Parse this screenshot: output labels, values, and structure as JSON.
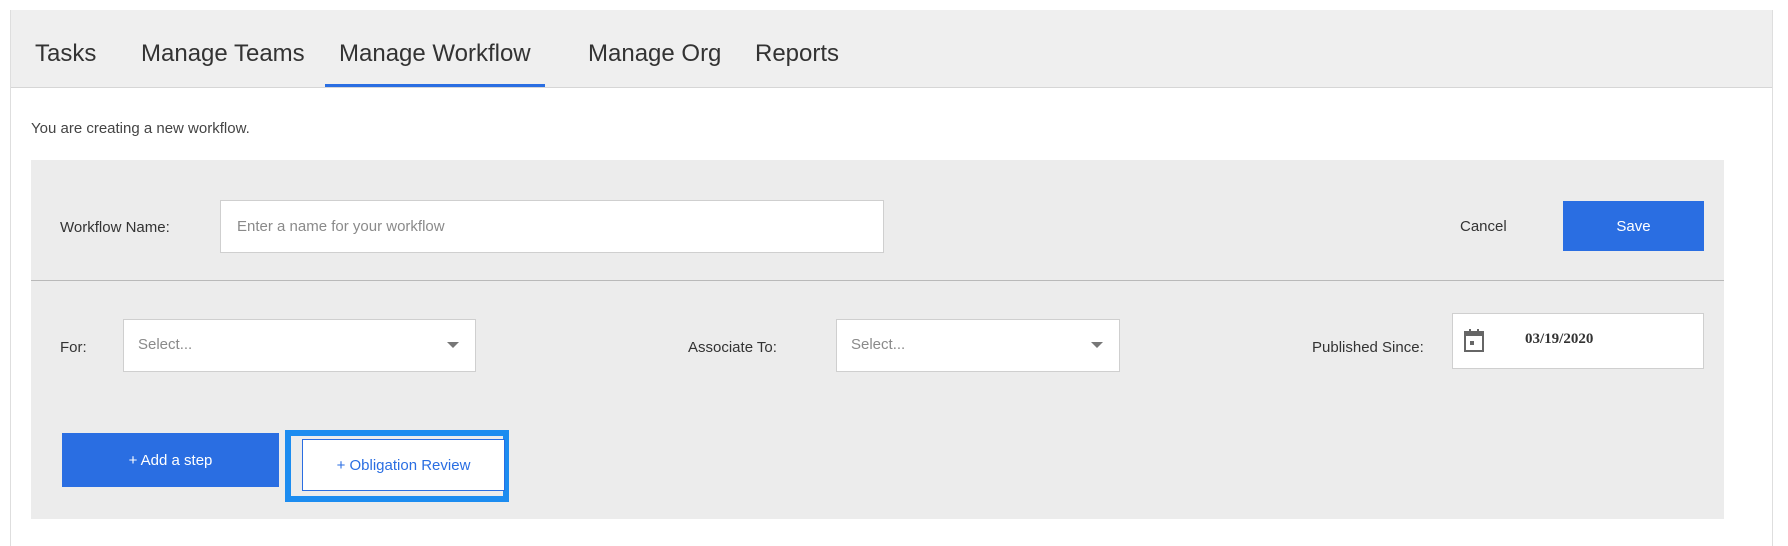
{
  "tabs": [
    {
      "label": "Tasks"
    },
    {
      "label": "Manage Teams"
    },
    {
      "label": "Manage Workflow",
      "active": true
    },
    {
      "label": "Manage Org"
    },
    {
      "label": "Reports"
    }
  ],
  "intro_text": "You are creating a new workflow.",
  "form": {
    "workflow_name_label": "Workflow Name:",
    "workflow_name_placeholder": "Enter a name for your workflow",
    "workflow_name_value": "",
    "cancel_label": "Cancel",
    "save_label": "Save",
    "for_label": "For:",
    "for_select_value": "Select...",
    "associate_label": "Associate To:",
    "associate_select_value": "Select...",
    "published_since_label": "Published Since:",
    "published_since_value": "03/19/2020",
    "calendar_icon": "calendar-icon",
    "add_step_label": "+ Add a step",
    "obligation_review_label": "+ Obligation Review"
  },
  "colors": {
    "accent": "#2a6ee2",
    "highlight": "#1c8cf0",
    "panel_bg": "#ececec",
    "tabbar_bg": "#efefef"
  }
}
